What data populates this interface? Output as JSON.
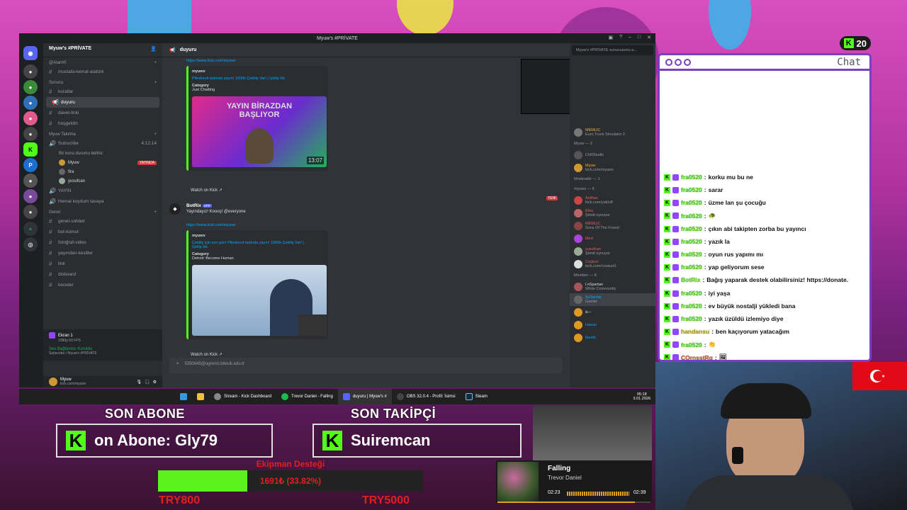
{
  "discord": {
    "window_title": "Myuw's #PRİVATE",
    "server_name": "Myuw's #PRİVATE",
    "channel_header": "duyuru",
    "members_header_search": "Myuw's #PRİVATE sunucusunu a...",
    "categories": [
      {
        "name": "@Atam®",
        "channels": [
          "mustafa-kemal-atatürk"
        ]
      },
      {
        "name": "Sunucu",
        "channels": [
          "kurallar",
          "duyuru",
          "davet-linki",
          "hoşgeldin"
        ]
      },
      {
        "name": "Myuw Takılma",
        "channels": []
      },
      {
        "name": "Genel",
        "channels": [
          "genel-sohbet",
          "bot-komut",
          "fotoğraf-video",
          "yayından-kesitler",
          "link",
          "disboard",
          "booster"
        ]
      }
    ],
    "voice": {
      "channel": "Subscribe",
      "status": "Bir konu durumu belirle",
      "time": "4:12:14",
      "users": [
        "Myuw",
        "fira",
        "yusufcan"
      ],
      "live_badge": "YAYINDA",
      "other_voice": [
        "YAYIN",
        "Hemal koydum tavaya"
      ]
    },
    "screen_share": {
      "title": "Ekran 1",
      "sub": "1080p 60 FPS"
    },
    "connection": {
      "title": "Ses Bağlantısı Kuruldu",
      "sub": "Subscribe / Myuw's #PRİVATE"
    },
    "user": {
      "name": "Myuw",
      "status": "kick.com/myuwv"
    },
    "messages": [
      {
        "link": "https://www.kick.com/myuwv",
        "author": "myuwv",
        "embed_title": "Pileskevit tadında yayın! 1000k Çekiliş Var! | İçkiliş İdc",
        "category_label": "Category",
        "category": "Just Chatting",
        "thumb_text": [
          "YAYIN BİRAZDAN",
          "BAŞLIYOR"
        ],
        "duration": "13:07",
        "watch": "Watch on Kick"
      },
      {
        "author": "BotRix",
        "tag": "APP",
        "text": "Yayındayız! Koooş! @everyone",
        "link": "https://www.kick.com/myuwv",
        "embed_author": "myuwv",
        "embed_title": "Çekiliş için son gün! Pileskevit tadında yayın! 1000k Çekiliş Var! | İçkiliş İdc",
        "category_label": "Category",
        "category": "Detroit: Become Human",
        "watch": "Watch on Kick",
        "new_badge": "YENİ"
      }
    ],
    "compose_text": "5350845@ogrenci.bilecik.edu.tr",
    "members": [
      {
        "group": "",
        "name": "MEMLIC",
        "sub": "Euro Truck Simulator 2"
      },
      {
        "group": "Myuw — 2",
        "name": "ChillStudio",
        "sub": ""
      },
      {
        "group": "",
        "name": "Myuw",
        "sub": "kick.com/myuwv"
      },
      {
        "group": "Moderatör — 1",
        "name": "",
        "sub": ""
      },
      {
        "group": "myuws — 6",
        "name": "Ardhan",
        "sub": "kick.com/yaklu8"
      },
      {
        "group": "",
        "name": "Efes",
        "sub": "Şimdi oynuyor"
      },
      {
        "group": "",
        "name": "MEMLIC",
        "sub": "Sons Of The Forest"
      },
      {
        "group": "",
        "name": "Mert",
        "sub": ""
      },
      {
        "group": "",
        "name": "yusufcan",
        "sub": "Şimdi oynuyor"
      },
      {
        "group": "",
        "name": "Coşkun",
        "sub": "kick.com/coskun0"
      },
      {
        "group": "Member — 8",
        "name": "l.nSpartan",
        "sub": "White Community"
      },
      {
        "group": "",
        "name": "AsSerdar",
        "sub": "Gamer"
      },
      {
        "group": "",
        "name": "ā—",
        "sub": ""
      },
      {
        "group": "",
        "name": "Hasan",
        "sub": ""
      },
      {
        "group": "",
        "name": "Ikeeth",
        "sub": ""
      }
    ]
  },
  "taskbar": {
    "apps": [
      "Stream - Kick Dashboard",
      "Trevor Daniel - Falling",
      "duyuru | Myuw's #",
      "OBS 32.0.4 - Profil: İsimsi",
      "Steam"
    ],
    "time": "05:18",
    "date": "3.01.2026"
  },
  "kick_viewers": "20",
  "chat": {
    "title": "Chat",
    "messages": [
      {
        "user": "fra0520",
        "text": "korku mu bu ne"
      },
      {
        "user": "fra0520",
        "text": "sarar"
      },
      {
        "user": "fra0520",
        "text": "üzme lan şu çocuğu"
      },
      {
        "user": "fra0520",
        "text": "🐢"
      },
      {
        "user": "fra0520",
        "text": "çıkın abi takipten zorba bu yayıncı"
      },
      {
        "user": "fra0520",
        "text": "yazık la"
      },
      {
        "user": "fra0520",
        "text": "oyun rus yapımı mı"
      },
      {
        "user": "fra0520",
        "text": "yap geliyorum sese"
      },
      {
        "user": "BotRix",
        "text": "Bağış yaparak destek olabilirsiniz! https://donate."
      },
      {
        "user": "fra0520",
        "text": "iyi yaşa"
      },
      {
        "user": "fra0520",
        "text": "ev büyük nostalji yükledi bana"
      },
      {
        "user": "fra0520",
        "text": "yazık üzüldü izlemiyo diye"
      },
      {
        "user": "handansu",
        "text": "ben kaçıyorum yatacağım"
      },
      {
        "user": "fra0520",
        "text": "👏"
      },
      {
        "user": "COrnsstRg",
        "text": "🖼"
      }
    ]
  },
  "overlay": {
    "son_abone_label": "SON ABONE",
    "son_abone_value": "on Abone: Gly79",
    "son_takipci_label": "SON TAKİPÇİ",
    "son_takipci_value": "Suiremcan",
    "goal_title": "Ekipman Desteği",
    "goal_text": "1691₺ (33.82%)",
    "goal_progress": 0.3382,
    "goal_min": "TRY800",
    "goal_max": "TRY5000"
  },
  "music": {
    "title": "Falling",
    "artist": "Trevor Daniel",
    "current": "02:23",
    "total": "02:39",
    "progress": 0.9
  },
  "colors": {
    "kick_green": "#53fc18",
    "discord_bg": "#313338",
    "chat_border": "#7b3fc4",
    "alert_red": "#e02020"
  }
}
